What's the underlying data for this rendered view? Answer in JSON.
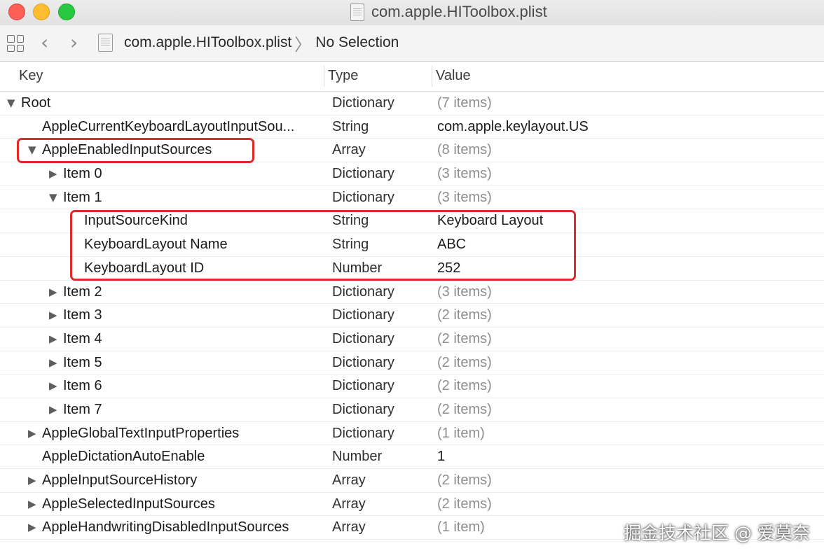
{
  "window": {
    "title": "com.apple.HIToolbox.plist"
  },
  "breadcrumb": {
    "file": "com.apple.HIToolbox.plist",
    "separator": "〉",
    "selection": "No Selection"
  },
  "columns": {
    "key": "Key",
    "type": "Type",
    "value": "Value"
  },
  "rows": [
    {
      "key": "Root",
      "type": "Dictionary",
      "value": "(7 items)",
      "level": 0,
      "disclosure": "expanded",
      "muted": true
    },
    {
      "key": "AppleCurrentKeyboardLayoutInputSou...",
      "type": "String",
      "value": "com.apple.keylayout.US",
      "level": 1,
      "disclosure": "none",
      "muted": false
    },
    {
      "key": "AppleEnabledInputSources",
      "type": "Array",
      "value": "(8 items)",
      "level": 1,
      "disclosure": "expanded",
      "muted": true
    },
    {
      "key": "Item 0",
      "type": "Dictionary",
      "value": "(3 items)",
      "level": 2,
      "disclosure": "collapsed",
      "muted": true
    },
    {
      "key": "Item 1",
      "type": "Dictionary",
      "value": "(3 items)",
      "level": 2,
      "disclosure": "expanded",
      "muted": true
    },
    {
      "key": "InputSourceKind",
      "type": "String",
      "value": "Keyboard Layout",
      "level": 3,
      "disclosure": "none",
      "muted": false
    },
    {
      "key": "KeyboardLayout Name",
      "type": "String",
      "value": "ABC",
      "level": 3,
      "disclosure": "none",
      "muted": false
    },
    {
      "key": "KeyboardLayout ID",
      "type": "Number",
      "value": "252",
      "level": 3,
      "disclosure": "none",
      "muted": false
    },
    {
      "key": "Item 2",
      "type": "Dictionary",
      "value": "(3 items)",
      "level": 2,
      "disclosure": "collapsed",
      "muted": true
    },
    {
      "key": "Item 3",
      "type": "Dictionary",
      "value": "(2 items)",
      "level": 2,
      "disclosure": "collapsed",
      "muted": true
    },
    {
      "key": "Item 4",
      "type": "Dictionary",
      "value": "(2 items)",
      "level": 2,
      "disclosure": "collapsed",
      "muted": true
    },
    {
      "key": "Item 5",
      "type": "Dictionary",
      "value": "(2 items)",
      "level": 2,
      "disclosure": "collapsed",
      "muted": true
    },
    {
      "key": "Item 6",
      "type": "Dictionary",
      "value": "(2 items)",
      "level": 2,
      "disclosure": "collapsed",
      "muted": true
    },
    {
      "key": "Item 7",
      "type": "Dictionary",
      "value": "(2 items)",
      "level": 2,
      "disclosure": "collapsed",
      "muted": true
    },
    {
      "key": "AppleGlobalTextInputProperties",
      "type": "Dictionary",
      "value": "(1 item)",
      "level": 1,
      "disclosure": "collapsed",
      "muted": true
    },
    {
      "key": "AppleDictationAutoEnable",
      "type": "Number",
      "value": "1",
      "level": 1,
      "disclosure": "none",
      "muted": false
    },
    {
      "key": "AppleInputSourceHistory",
      "type": "Array",
      "value": "(2 items)",
      "level": 1,
      "disclosure": "collapsed",
      "muted": true
    },
    {
      "key": "AppleSelectedInputSources",
      "type": "Array",
      "value": "(2 items)",
      "level": 1,
      "disclosure": "collapsed",
      "muted": true
    },
    {
      "key": "AppleHandwritingDisabledInputSources",
      "type": "Array",
      "value": "(1 item)",
      "level": 1,
      "disclosure": "collapsed",
      "muted": true
    }
  ],
  "annotations": {
    "highlight_color": "#e02a2a"
  },
  "watermark": "掘金技术社区 @ 爱莫奈"
}
